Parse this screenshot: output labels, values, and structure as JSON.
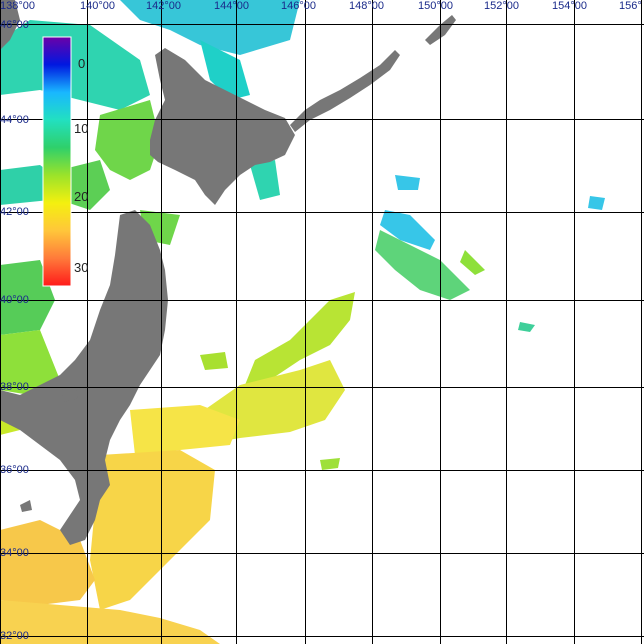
{
  "map": {
    "longitude_labels": [
      "138°00",
      "140°00",
      "142°00",
      "144°00",
      "146°00",
      "148°00",
      "150°00",
      "152°00",
      "154°00",
      "156°"
    ],
    "latitude_labels": [
      "46°00",
      "44°00",
      "42°00",
      "40°00",
      "38°00",
      "36°00",
      "34°00",
      "32°00"
    ],
    "colors": {
      "land": "#777777",
      "grid": "#000000",
      "background": "#ffffff",
      "label_text": "#1a2a8a"
    }
  },
  "legend": {
    "tick_labels": [
      "0",
      "10",
      "20",
      "30"
    ],
    "color_stops": [
      "#6b00a8",
      "#0018e0",
      "#19b7ff",
      "#22e0c0",
      "#2fd06a",
      "#9be32a",
      "#f4f00f",
      "#ffc63a",
      "#ff7a3a",
      "#ff1a1a"
    ]
  }
}
